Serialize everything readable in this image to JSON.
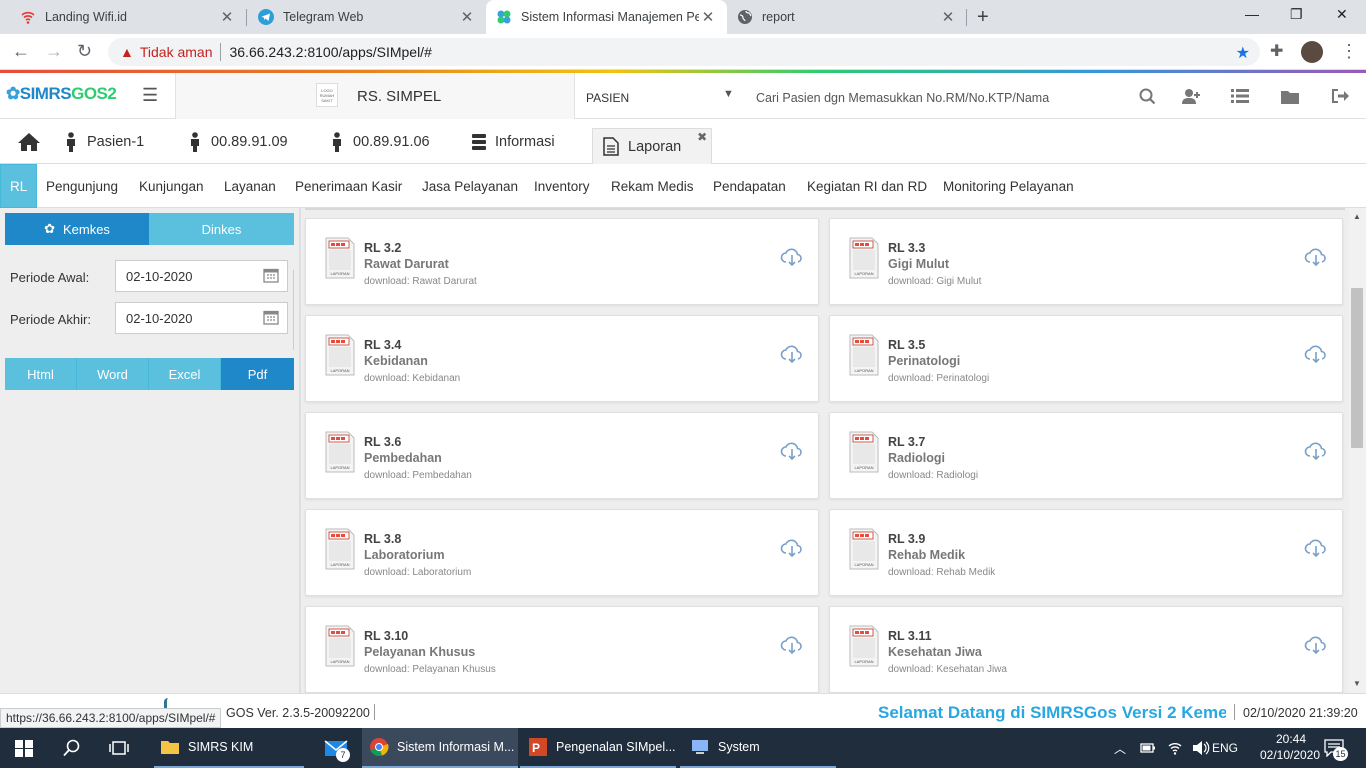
{
  "browser": {
    "tabs": [
      {
        "title": "Landing Wifi.id",
        "icon": "wifi-icon"
      },
      {
        "title": "Telegram Web",
        "icon": "telegram-icon"
      },
      {
        "title": "Sistem Informasi Manajemen Pel",
        "icon": "simrs-icon",
        "active": true
      },
      {
        "title": "report",
        "icon": "globe-icon"
      }
    ],
    "security_label": "Tidak aman",
    "url": "36.66.243.2:8100/apps/SIMpel/#"
  },
  "header": {
    "logo": {
      "prefix": "SIMRS",
      "suffix": "GOS2"
    },
    "hospital_logo_text": "LOGO RUMAH SAKIT",
    "hospital_name": "RS. SIMPEL",
    "patient_select": "PASIEN",
    "search_placeholder": "Cari Pasien dgn Memasukkan No.RM/No.KTP/Nama"
  },
  "menu_tabs": [
    {
      "label": "Pasien-1",
      "icon": "person-icon"
    },
    {
      "label": "00.89.91.09",
      "icon": "person-icon"
    },
    {
      "label": "00.89.91.06",
      "icon": "person-icon"
    },
    {
      "label": "Informasi",
      "icon": "database-icon"
    },
    {
      "label": "Laporan",
      "icon": "document-icon",
      "active": true
    }
  ],
  "sub_nav": [
    "RL",
    "Pengunjung",
    "Kunjungan",
    "Layanan",
    "Penerimaan Kasir",
    "Jasa Pelayanan",
    "Inventory",
    "Rekam Medis",
    "Pendapatan",
    "Kegiatan RI dan RD",
    "Monitoring Pelayanan"
  ],
  "left_panel": {
    "source_buttons": [
      {
        "label": "Kemkes",
        "active": true
      },
      {
        "label": "Dinkes"
      }
    ],
    "periode_awal_label": "Periode Awal:",
    "periode_awal_value": "02-10-2020",
    "periode_akhir_label": "Periode Akhir:",
    "periode_akhir_value": "02-10-2020",
    "export_buttons": [
      {
        "label": "Html"
      },
      {
        "label": "Word"
      },
      {
        "label": "Excel"
      },
      {
        "label": "Pdf",
        "active": true
      }
    ]
  },
  "reports": [
    {
      "code": "RL 3.2",
      "name": "Rawat Darurat",
      "download": "download: Rawat Darurat"
    },
    {
      "code": "RL 3.3",
      "name": "Gigi Mulut",
      "download": "download: Gigi Mulut"
    },
    {
      "code": "RL 3.4",
      "name": "Kebidanan",
      "download": "download: Kebidanan"
    },
    {
      "code": "RL 3.5",
      "name": "Perinatologi",
      "download": "download: Perinatologi"
    },
    {
      "code": "RL 3.6",
      "name": "Pembedahan",
      "download": "download: Pembedahan"
    },
    {
      "code": "RL 3.7",
      "name": "Radiologi",
      "download": "download: Radiologi"
    },
    {
      "code": "RL 3.8",
      "name": "Laboratorium",
      "download": "download: Laboratorium"
    },
    {
      "code": "RL 3.9",
      "name": "Rehab Medik",
      "download": "download: Rehab Medik"
    },
    {
      "code": "RL 3.10",
      "name": "Pelayanan Khusus",
      "download": "download: Pelayanan Khusus"
    },
    {
      "code": "RL 3.11",
      "name": "Kesehatan Jiwa",
      "download": "download: Kesehatan Jiwa"
    }
  ],
  "doc_label": "LAPORAN",
  "status": {
    "hover_url": "https://36.66.243.2:8100/apps/SIMpel/#",
    "version": "GOS Ver. 2.3.5-20092200",
    "welcome": "Selamat Datang di SIMRSGos Versi 2 Keme",
    "datetime": "02/10/2020 21:39:20"
  },
  "taskbar": {
    "items": [
      {
        "label": "SIMRS KIM",
        "icon": "folder-icon"
      },
      {
        "label": "",
        "icon": "mail-icon",
        "badge": "7"
      },
      {
        "label": "Sistem Informasi M...",
        "icon": "chrome-icon",
        "active": true
      },
      {
        "label": "Pengenalan SIMpel...",
        "icon": "powerpoint-icon"
      },
      {
        "label": "System",
        "icon": "system-icon"
      }
    ],
    "lang": "ENG",
    "time": "20:44",
    "date": "02/10/2020",
    "notifications": "15"
  },
  "colors": {
    "accent": "#5bc0de",
    "active_blue": "#1e88c9",
    "welcome": "#29a7e1",
    "taskbar": "#1f2d3d"
  }
}
